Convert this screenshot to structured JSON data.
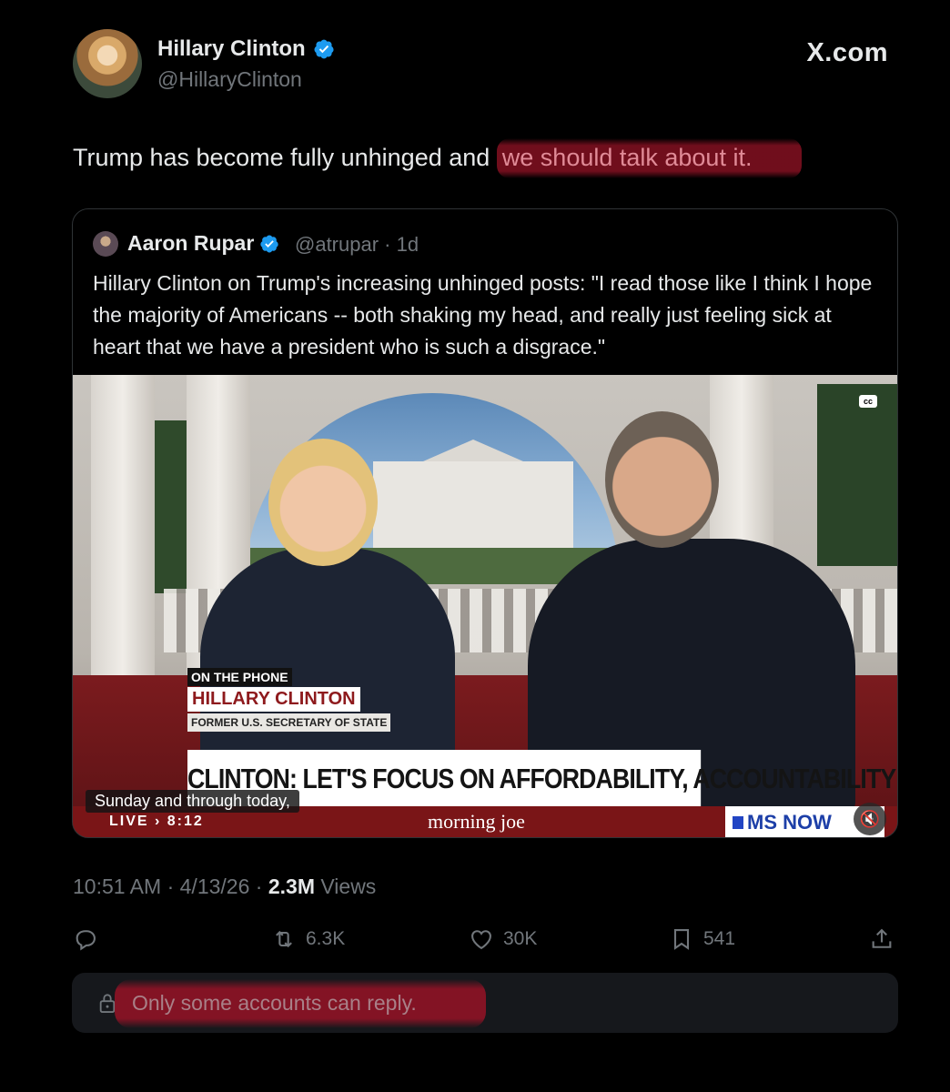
{
  "post": {
    "author_name": "Hillary Clinton",
    "author_handle": "@HillaryClinton",
    "site": "X.com",
    "text_plain": "Trump has become fully unhinged and ",
    "text_highlight": "we should talk about it.",
    "time": "10:51 AM",
    "date": "4/13/26",
    "views_count": "2.3M",
    "views_label": "Views",
    "reply_restriction": "Only some accounts can reply."
  },
  "quote": {
    "author_name": "Aaron Rupar",
    "author_handle": "@atrupar",
    "age": "1d",
    "text": "Hillary Clinton on Trump's increasing unhinged posts: \"I read those like I think I hope the majority of Americans -- both shaking my head, and really just feeling sick at heart that we have a president who is such a disgrace.\"",
    "video": {
      "cc_badge": "cc",
      "tag_top": "ON THE PHONE",
      "tag_name": "HILLARY CLINTON",
      "tag_title": "FORMER U.S. SECRETARY OF STATE",
      "chyron": "CLINTON: LET'S FOCUS ON AFFORDABILITY, ACCOUNTABILITY",
      "caption": "Sunday and through today,",
      "live": "LIVE › 8:12",
      "show": "morning joe",
      "network": "MS NOW"
    }
  },
  "actions": {
    "retweets": "6.3K",
    "likes": "30K",
    "bookmarks": "541"
  },
  "colors": {
    "background": "#000000",
    "text": "#e7e9ea",
    "muted": "#71767b",
    "verified": "#1d9bf0",
    "highlight": "#96122a"
  },
  "icons": [
    "verified-badge-icon",
    "reply-icon",
    "retweet-icon",
    "like-icon",
    "bookmark-icon",
    "share-icon",
    "lock-icon",
    "mute-icon"
  ]
}
